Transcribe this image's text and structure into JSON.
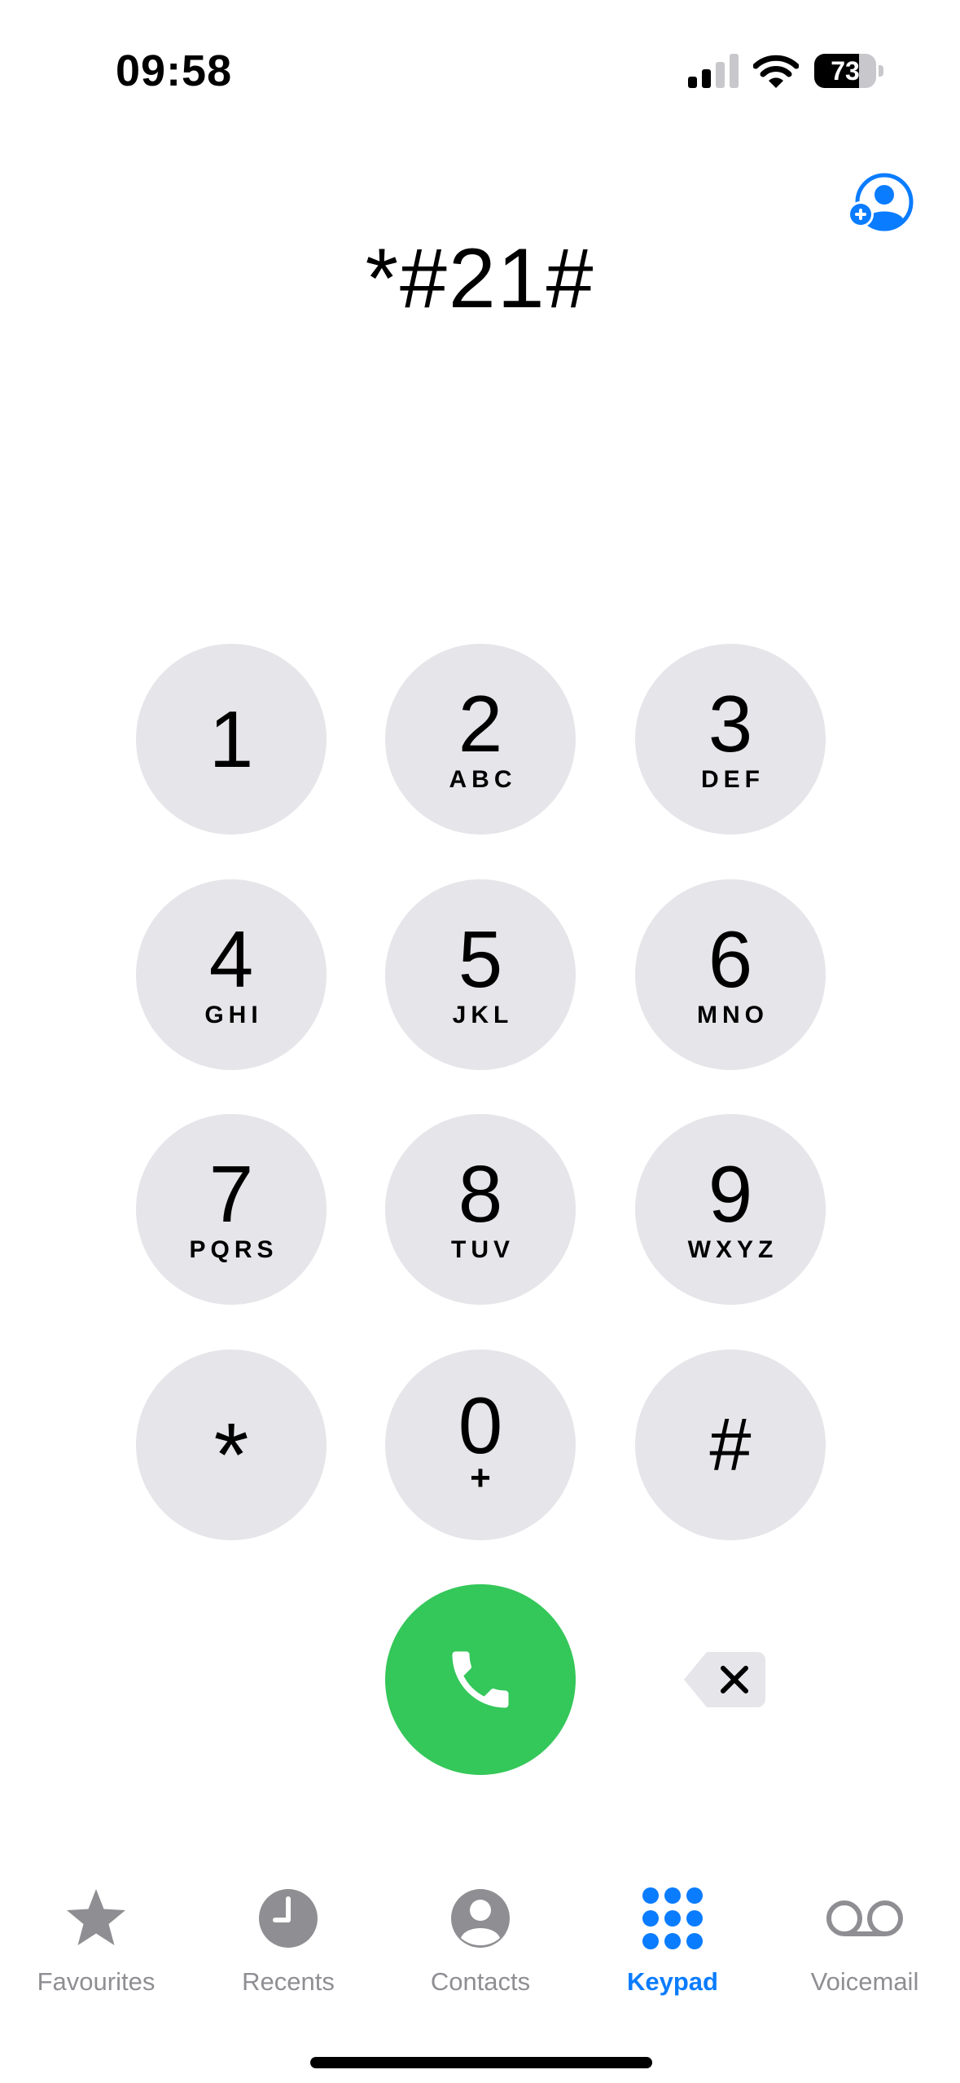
{
  "status_bar": {
    "time": "09:58",
    "battery_percent": "73",
    "battery_level": 0.73,
    "signal_bars_active": 2,
    "signal_bars_total": 4,
    "icons": [
      "signal-icon",
      "wifi-icon",
      "battery-icon"
    ]
  },
  "dialer": {
    "number": "*#21#",
    "add_contact_icon": "add-person-icon"
  },
  "keypad": {
    "keys": [
      {
        "digit": "1",
        "letters": ""
      },
      {
        "digit": "2",
        "letters": "ABC"
      },
      {
        "digit": "3",
        "letters": "DEF"
      },
      {
        "digit": "4",
        "letters": "GHI"
      },
      {
        "digit": "5",
        "letters": "JKL"
      },
      {
        "digit": "6",
        "letters": "MNO"
      },
      {
        "digit": "7",
        "letters": "PQRS"
      },
      {
        "digit": "8",
        "letters": "TUV"
      },
      {
        "digit": "9",
        "letters": "WXYZ"
      },
      {
        "digit": "*",
        "letters": ""
      },
      {
        "digit": "0",
        "letters": "+"
      },
      {
        "digit": "#",
        "letters": ""
      }
    ],
    "key_color": "#e5e5ea",
    "call_icon": "phone-icon",
    "call_color": "#34c759",
    "delete_icon": "delete-backspace-icon"
  },
  "tab_bar": {
    "active": "Keypad",
    "active_color": "#0a7cff",
    "inactive_color": "#8e8e93",
    "tabs": [
      {
        "label": "Favourites",
        "icon": "star-icon"
      },
      {
        "label": "Recents",
        "icon": "clock-icon"
      },
      {
        "label": "Contacts",
        "icon": "person-circle-icon"
      },
      {
        "label": "Keypad",
        "icon": "keypad-grid-icon"
      },
      {
        "label": "Voicemail",
        "icon": "voicemail-icon"
      }
    ]
  }
}
